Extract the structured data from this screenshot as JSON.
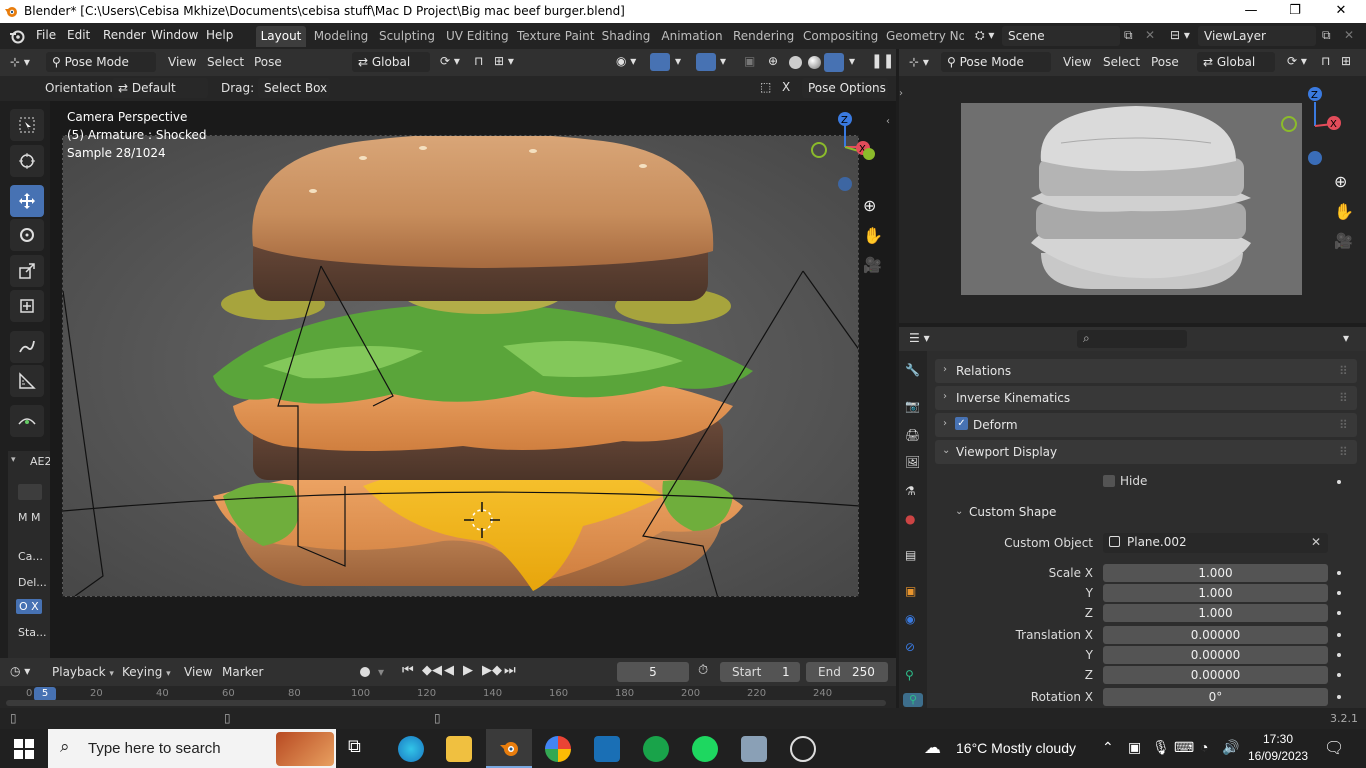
{
  "window": {
    "title": "Blender* [C:\\Users\\Cebisa Mkhize\\Documents\\cebisa stuff\\Mac D Project\\Big mac beef burger.blend]",
    "minimize": "—",
    "maximize": "❐",
    "close": "✕"
  },
  "menubar": {
    "items": [
      "File",
      "Edit",
      "Render",
      "Window",
      "Help"
    ],
    "workspaces": [
      "Layout",
      "Modeling",
      "Sculpting",
      "UV Editing",
      "Texture Paint",
      "Shading",
      "Animation",
      "Rendering",
      "Compositing",
      "Geometry Noc"
    ],
    "active_workspace": "Layout",
    "scene": "Scene",
    "view_layer": "ViewLayer"
  },
  "viewport_header": {
    "mode": "Pose Mode",
    "menus": [
      "View",
      "Select",
      "Pose"
    ],
    "transform_orientation": "Global"
  },
  "tool_header": {
    "orientation_label": "Orientation:",
    "orientation_value": "Default",
    "drag_label": "Drag:",
    "drag_value": "Select Box",
    "pose_options": "Pose Options"
  },
  "viewport": {
    "camera_label": "Camera Perspective",
    "armature_label": "(5) Armature : Shocked",
    "sample_label": "Sample 28/1024"
  },
  "sidebar_tab": {
    "label": "AE2",
    "items": [
      "M M",
      "Ca...",
      "Del...",
      "O X",
      "Sta..."
    ]
  },
  "preview_header": {
    "mode": "Pose Mode",
    "menus": [
      "View",
      "Select",
      "Pose"
    ],
    "transform_orientation": "Global"
  },
  "properties": {
    "panels": [
      {
        "label": "Relations",
        "open": false
      },
      {
        "label": "Inverse Kinematics",
        "open": false
      },
      {
        "label": "Deform",
        "open": false,
        "checkbox": true
      },
      {
        "label": "Viewport Display",
        "open": true
      }
    ],
    "hide_label": "Hide",
    "custom_shape": {
      "label": "Custom Shape",
      "custom_object_label": "Custom Object",
      "custom_object_value": "Plane.002",
      "scale_x_label": "Scale X",
      "scale_x": "1.000",
      "scale_y_label": "Y",
      "scale_y": "1.000",
      "scale_z_label": "Z",
      "scale_z": "1.000",
      "translation_x_label": "Translation X",
      "translation_x": "0.00000",
      "translation_y_label": "Y",
      "translation_y": "0.00000",
      "translation_z_label": "Z",
      "translation_z": "0.00000",
      "rotation_x_label": "Rotation X",
      "rotation_x": "0°"
    }
  },
  "timeline": {
    "menus": [
      "Playback",
      "Keying",
      "View",
      "Marker"
    ],
    "current_frame": "5",
    "start_label": "Start",
    "start": "1",
    "end_label": "End",
    "end": "250",
    "ruler": [
      "0",
      "20",
      "40",
      "60",
      "80",
      "100",
      "120",
      "140",
      "160",
      "180",
      "200",
      "220",
      "240"
    ],
    "cursor_frame": "5"
  },
  "statusbar": {
    "version": "3.2.1"
  },
  "taskbar": {
    "search_placeholder": "Type here to search",
    "weather": "16°C  Mostly cloudy",
    "time": "17:30",
    "date": "16/09/2023"
  },
  "colors": {
    "accent": "#4772b3",
    "axis_x": "#e24c5a",
    "axis_y": "#8bbb2b",
    "axis_z": "#3a7ae0"
  }
}
